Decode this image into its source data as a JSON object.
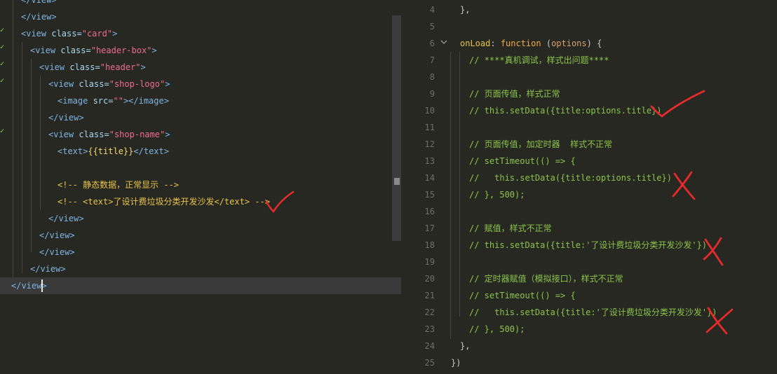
{
  "left_editor": {
    "lines": [
      {
        "i": 0,
        "parts": [
          [
            "tag",
            "</view>"
          ]
        ]
      },
      {
        "i": 0,
        "parts": [
          [
            "tag",
            "</view>"
          ]
        ]
      },
      {
        "i": 0,
        "parts": [
          [
            "tag",
            "<view "
          ],
          [
            "attr",
            "class="
          ],
          [
            "str",
            "\"card\""
          ],
          [
            "tag",
            ">"
          ]
        ]
      },
      {
        "i": 1,
        "parts": [
          [
            "tag",
            "<view "
          ],
          [
            "attr",
            "class="
          ],
          [
            "str",
            "\"header-box\""
          ],
          [
            "tag",
            ">"
          ]
        ]
      },
      {
        "i": 2,
        "parts": [
          [
            "tag",
            "<view "
          ],
          [
            "attr",
            "class="
          ],
          [
            "str",
            "\"header\""
          ],
          [
            "tag",
            ">"
          ]
        ]
      },
      {
        "i": 3,
        "parts": [
          [
            "tag",
            "<view "
          ],
          [
            "attr",
            "class="
          ],
          [
            "str",
            "\"shop-logo\""
          ],
          [
            "tag",
            ">"
          ]
        ]
      },
      {
        "i": 4,
        "parts": [
          [
            "tag",
            "<image "
          ],
          [
            "attr",
            "src="
          ],
          [
            "str",
            "\"\""
          ],
          [
            "tag",
            "></image>"
          ]
        ]
      },
      {
        "i": 3,
        "parts": [
          [
            "tag",
            "</view>"
          ]
        ]
      },
      {
        "i": 3,
        "parts": [
          [
            "tag",
            "<view "
          ],
          [
            "attr",
            "class="
          ],
          [
            "str",
            "\"shop-name\""
          ],
          [
            "tag",
            ">"
          ]
        ]
      },
      {
        "i": 4,
        "parts": [
          [
            "tag",
            "<text>"
          ],
          [
            "var",
            "{{title}}"
          ],
          [
            "tag",
            "</text>"
          ]
        ]
      },
      {
        "i": 4,
        "parts": []
      },
      {
        "i": 4,
        "parts": [
          [
            "key",
            "<!-- 静态数据，正常显示 -->"
          ]
        ]
      },
      {
        "i": 4,
        "parts": [
          [
            "key",
            "<!-- <text>了设计费垃圾分类开发沙发</text> -->"
          ]
        ]
      },
      {
        "i": 3,
        "parts": [
          [
            "tag",
            "</view>"
          ]
        ]
      },
      {
        "i": 2,
        "parts": [
          [
            "tag",
            "</view>"
          ]
        ]
      },
      {
        "i": 2,
        "parts": [
          [
            "tag",
            "</view>"
          ]
        ]
      },
      {
        "i": 1,
        "parts": [
          [
            "tag",
            "</view>"
          ]
        ]
      },
      {
        "i": 0,
        "parts": [
          [
            "tag",
            "</view>"
          ]
        ]
      }
    ]
  },
  "right_editor": {
    "lines": [
      {
        "n": "4",
        "i": 1,
        "parts": [
          [
            "pun",
            "},"
          ]
        ]
      },
      {
        "n": "5",
        "i": 1,
        "parts": []
      },
      {
        "n": "6",
        "i": 1,
        "parts": [
          [
            "key",
            "onLoad"
          ],
          [
            "pun",
            ": "
          ],
          [
            "kw",
            "function"
          ],
          [
            "pun",
            " ("
          ],
          [
            "param",
            "options"
          ],
          [
            "pun",
            ") {"
          ]
        ]
      },
      {
        "n": "7",
        "i": 2,
        "parts": [
          [
            "cmt",
            "// ****真机调试，样式出问题****"
          ]
        ]
      },
      {
        "n": "8",
        "i": 2,
        "parts": []
      },
      {
        "n": "9",
        "i": 2,
        "parts": [
          [
            "cmt",
            "// 页面传值，样式正常"
          ]
        ]
      },
      {
        "n": "10",
        "i": 2,
        "parts": [
          [
            "cmt",
            "// this.setData({title:options.title})"
          ]
        ]
      },
      {
        "n": "11",
        "i": 2,
        "parts": []
      },
      {
        "n": "12",
        "i": 2,
        "parts": [
          [
            "cmt",
            "// 页面传值，加定时器  样式不正常"
          ]
        ]
      },
      {
        "n": "13",
        "i": 2,
        "parts": [
          [
            "cmt",
            "// setTimeout(() => {"
          ]
        ]
      },
      {
        "n": "14",
        "i": 2,
        "parts": [
          [
            "cmt",
            "//   this.setData({title:options.title})"
          ]
        ]
      },
      {
        "n": "15",
        "i": 2,
        "parts": [
          [
            "cmt",
            "// }, 500);"
          ]
        ]
      },
      {
        "n": "16",
        "i": 2,
        "parts": []
      },
      {
        "n": "17",
        "i": 2,
        "parts": [
          [
            "cmt",
            "// 赋值，样式不正常"
          ]
        ]
      },
      {
        "n": "18",
        "i": 2,
        "parts": [
          [
            "cmt",
            "// this.setData({title:'了设计费垃圾分类开发沙发'})"
          ]
        ]
      },
      {
        "n": "19",
        "i": 2,
        "parts": []
      },
      {
        "n": "20",
        "i": 2,
        "parts": [
          [
            "cmt",
            "// 定时器赋值（模拟接口），样式不正常"
          ]
        ]
      },
      {
        "n": "21",
        "i": 2,
        "parts": [
          [
            "cmt",
            "// setTimeout(() => {"
          ]
        ]
      },
      {
        "n": "22",
        "i": 2,
        "parts": [
          [
            "cmt",
            "//   this.setData({title:'了设计费垃圾分类开发沙发'})"
          ]
        ]
      },
      {
        "n": "23",
        "i": 2,
        "parts": [
          [
            "cmt",
            "// }, 500);"
          ]
        ]
      },
      {
        "n": "24",
        "i": 1,
        "parts": [
          [
            "pun",
            "},"
          ]
        ]
      },
      {
        "n": "25",
        "i": 0,
        "parts": [
          [
            "pun",
            "})"
          ]
        ]
      }
    ]
  }
}
